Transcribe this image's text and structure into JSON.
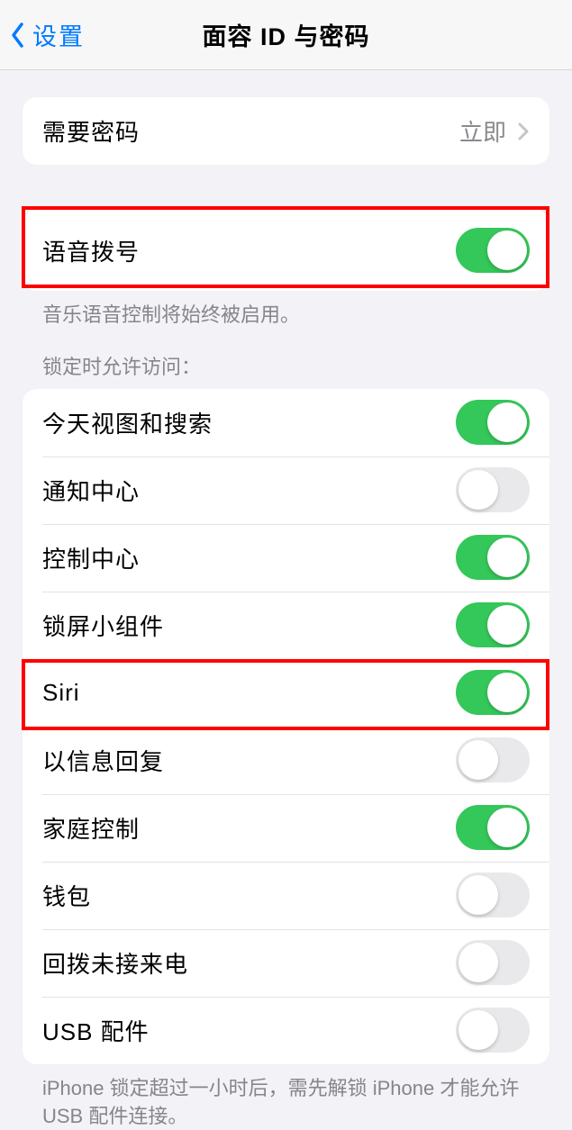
{
  "nav": {
    "back_label": "设置",
    "title": "面容 ID 与密码"
  },
  "passcode_section": {
    "label": "需要密码",
    "value": "立即"
  },
  "voice_dial": {
    "label": "语音拨号",
    "on": true,
    "footer": "音乐语音控制将始终被启用。"
  },
  "lock_access": {
    "header": "锁定时允许访问：",
    "items": [
      {
        "label": "今天视图和搜索",
        "on": true
      },
      {
        "label": "通知中心",
        "on": false
      },
      {
        "label": "控制中心",
        "on": true
      },
      {
        "label": "锁屏小组件",
        "on": true
      },
      {
        "label": "Siri",
        "on": true
      },
      {
        "label": "以信息回复",
        "on": false
      },
      {
        "label": "家庭控制",
        "on": true
      },
      {
        "label": "钱包",
        "on": false
      },
      {
        "label": "回拨未接来电",
        "on": false
      },
      {
        "label": "USB 配件",
        "on": false
      }
    ],
    "footer": "iPhone 锁定超过一小时后，需先解锁 iPhone 才能允许 USB 配件连接。"
  }
}
